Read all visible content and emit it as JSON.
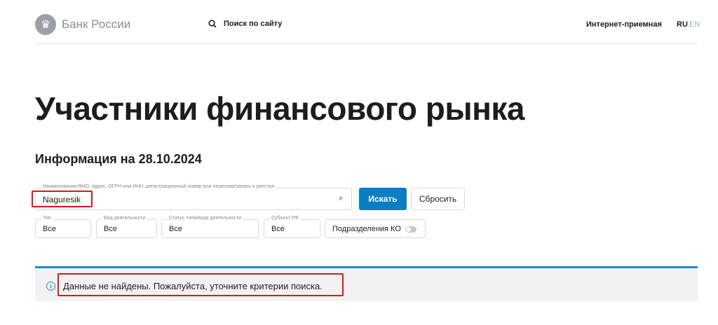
{
  "header": {
    "brand": "Банк России",
    "search_label": "Поиск по сайту",
    "reception": "Интернет-приемная",
    "lang_ru": "RU",
    "lang_en": "EN"
  },
  "page": {
    "title": "Участники финансового рынка",
    "subtitle": "Информация на 28.10.2024"
  },
  "search": {
    "label": "Наименование/ФИО, адрес, ОГРН или ИНН, регистрационный номер или лицензия/запись в реестре",
    "value": "Naguresik",
    "clear": "×",
    "submit": "Искать",
    "reset": "Сбросить"
  },
  "filters": [
    {
      "label": "Тип",
      "value": "Все"
    },
    {
      "label": "Вид деятельности",
      "value": "Все"
    },
    {
      "label": "Статус типа/вида деятельности",
      "value": "Все"
    },
    {
      "label": "Субъект РФ",
      "value": "Все"
    }
  ],
  "toggle": {
    "label": "Подразделения КО",
    "on": false
  },
  "message": {
    "text": "Данные не найдены. Пожалуйста, уточните критерии поиска.",
    "icon": "i"
  },
  "colors": {
    "accent": "#0a7ec2",
    "highlight": "#e0141e"
  }
}
